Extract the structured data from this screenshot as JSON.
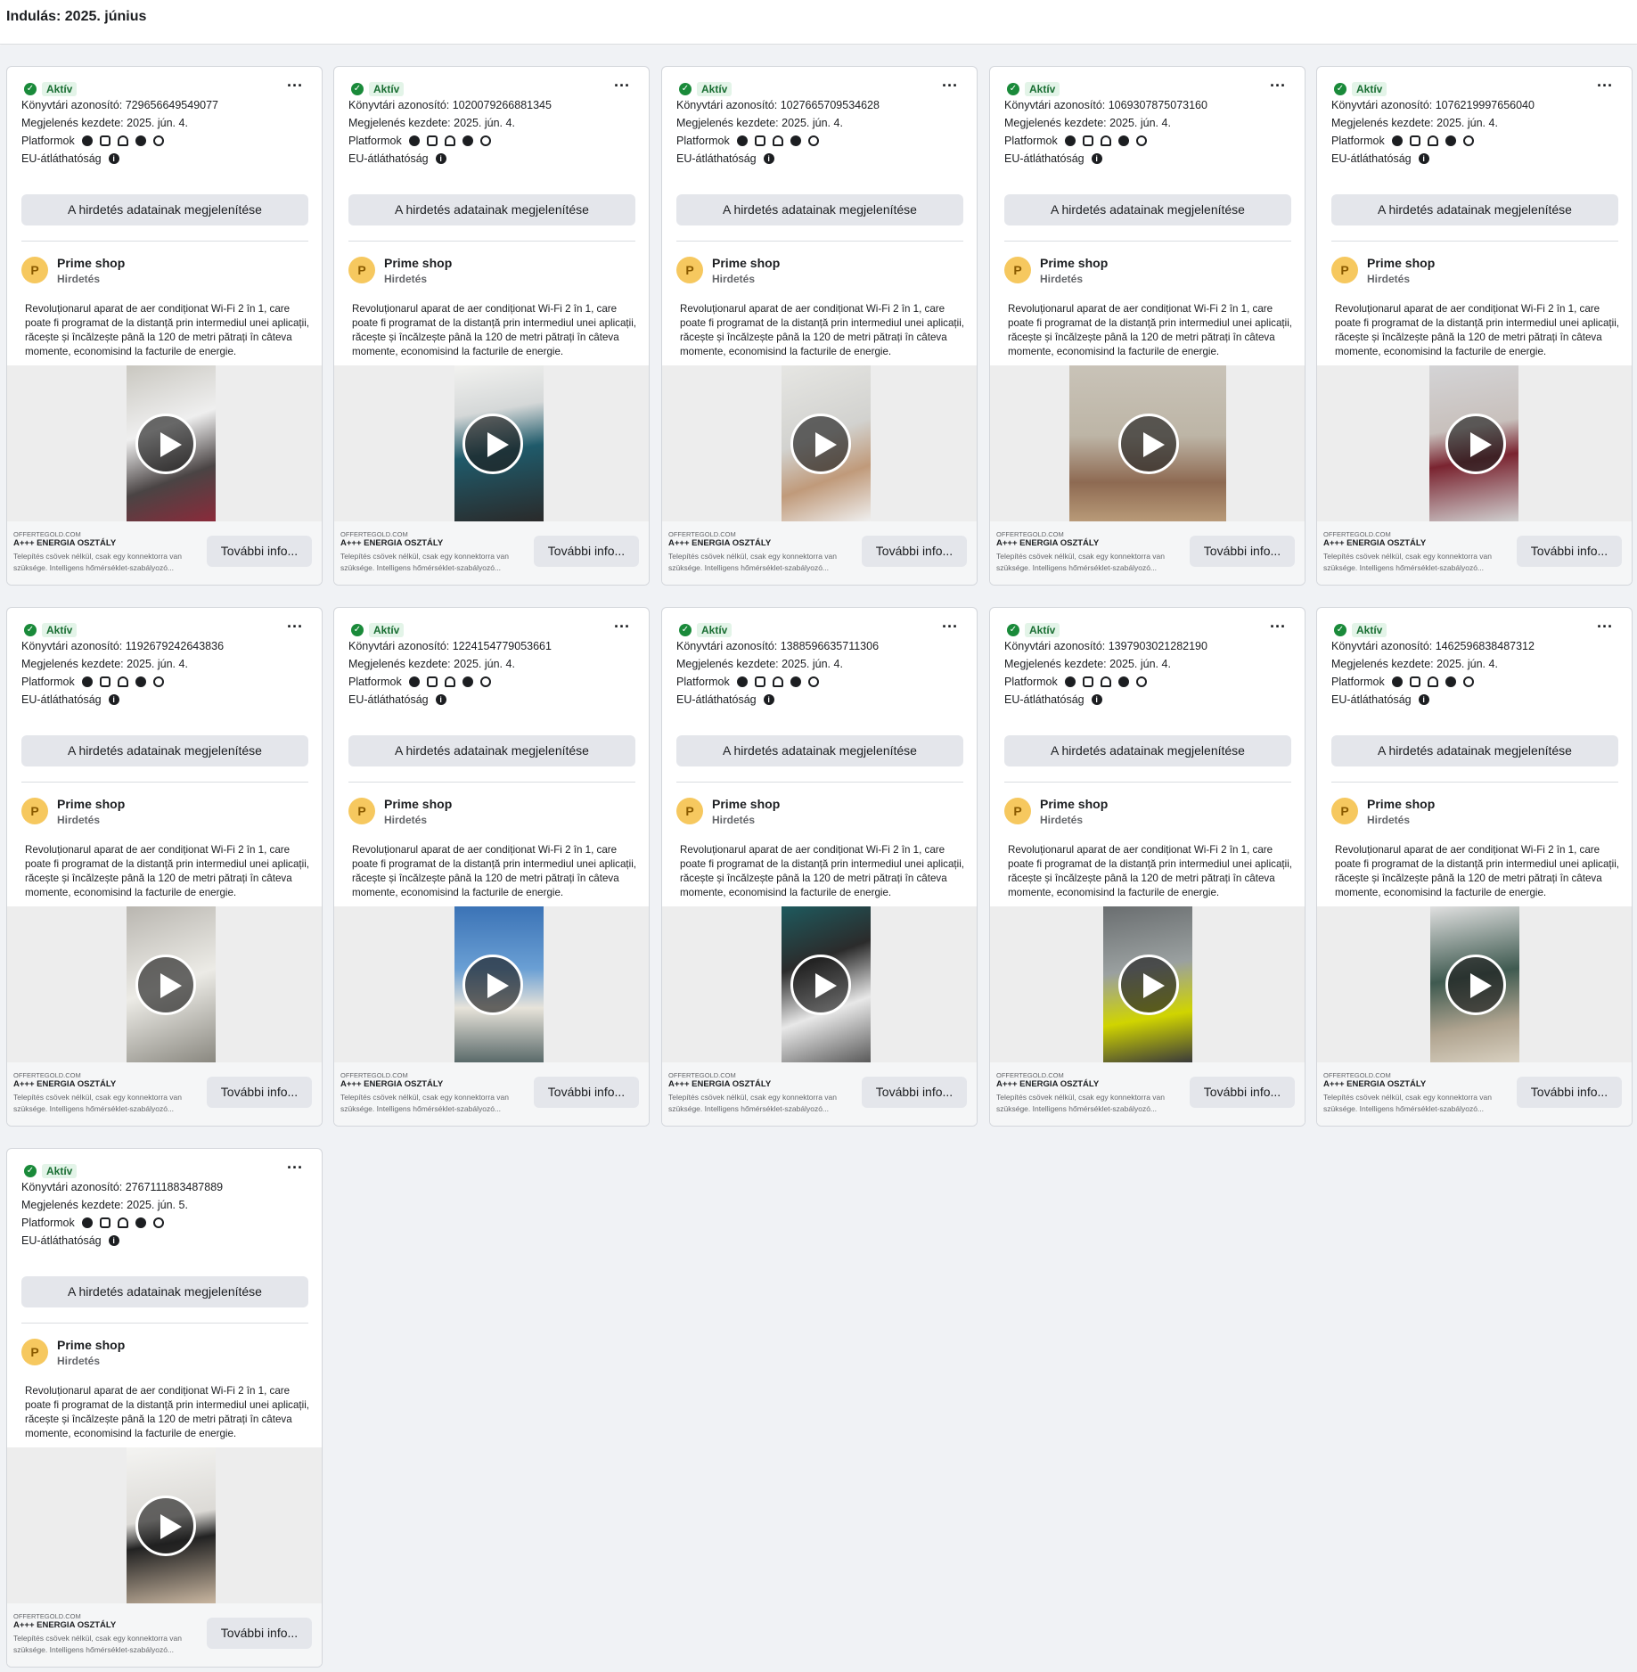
{
  "header": {
    "title": "Indulás: 2025. június"
  },
  "common": {
    "status_label": "Aktív",
    "more_label": "···",
    "platforms_label": "Platformok",
    "platform_icons": [
      "facebook-icon",
      "instagram-icon",
      "audience-network-icon",
      "messenger-icon",
      "threads-icon"
    ],
    "eu_label": "EU-átláthatóság",
    "details_button": "A hirdetés adatainak megjelenítése",
    "advertiser_initial": "P",
    "advertiser_name": "Prime shop",
    "advertiser_sub": "Hirdetés",
    "ad_text": "Revoluționarul aparat de aer condiționat Wi-Fi 2 în 1, care poate fi programat de la distanță prin intermediul unei aplicații, răcește și încălzește până la 120 de metri pătrați în câteva momente, economisind la facturile de energie.",
    "footer_domain": "OFFERTEGOLD.COM",
    "footer_title": "A+++ ENERGIA OSZTÁLY",
    "footer_desc": "Telepítés csövek nélkül, csak egy konnektorra van szüksége. Intelligens hőmérséklet-szabályozó...",
    "cta_label": "További info..."
  },
  "cards": [
    {
      "id": "Könyvtári azonosító: 729656649549077",
      "start": "Megjelenés kezdete: 2025. jún. 4."
    },
    {
      "id": "Könyvtári azonosító: 1020079266881345",
      "start": "Megjelenés kezdete: 2025. jún. 4."
    },
    {
      "id": "Könyvtári azonosító: 1027665709534628",
      "start": "Megjelenés kezdete: 2025. jún. 4."
    },
    {
      "id": "Könyvtári azonosító: 1069307875073160",
      "start": "Megjelenés kezdete: 2025. jún. 4."
    },
    {
      "id": "Könyvtári azonosító: 1076219997656040",
      "start": "Megjelenés kezdete: 2025. jún. 4."
    },
    {
      "id": "Könyvtári azonosító: 1192679242643836",
      "start": "Megjelenés kezdete: 2025. jún. 4."
    },
    {
      "id": "Könyvtári azonosító: 1224154779053661",
      "start": "Megjelenés kezdete: 2025. jún. 4."
    },
    {
      "id": "Könyvtári azonosító: 1388596635711306",
      "start": "Megjelenés kezdete: 2025. jún. 4."
    },
    {
      "id": "Könyvtári azonosító: 1397903021282190",
      "start": "Megjelenés kezdete: 2025. jún. 4."
    },
    {
      "id": "Könyvtári azonosító: 1462596838487312",
      "start": "Megjelenés kezdete: 2025. jún. 4."
    },
    {
      "id": "Könyvtári azonosító: 2767111883487889",
      "start": "Megjelenés kezdete: 2025. jún. 5."
    }
  ]
}
